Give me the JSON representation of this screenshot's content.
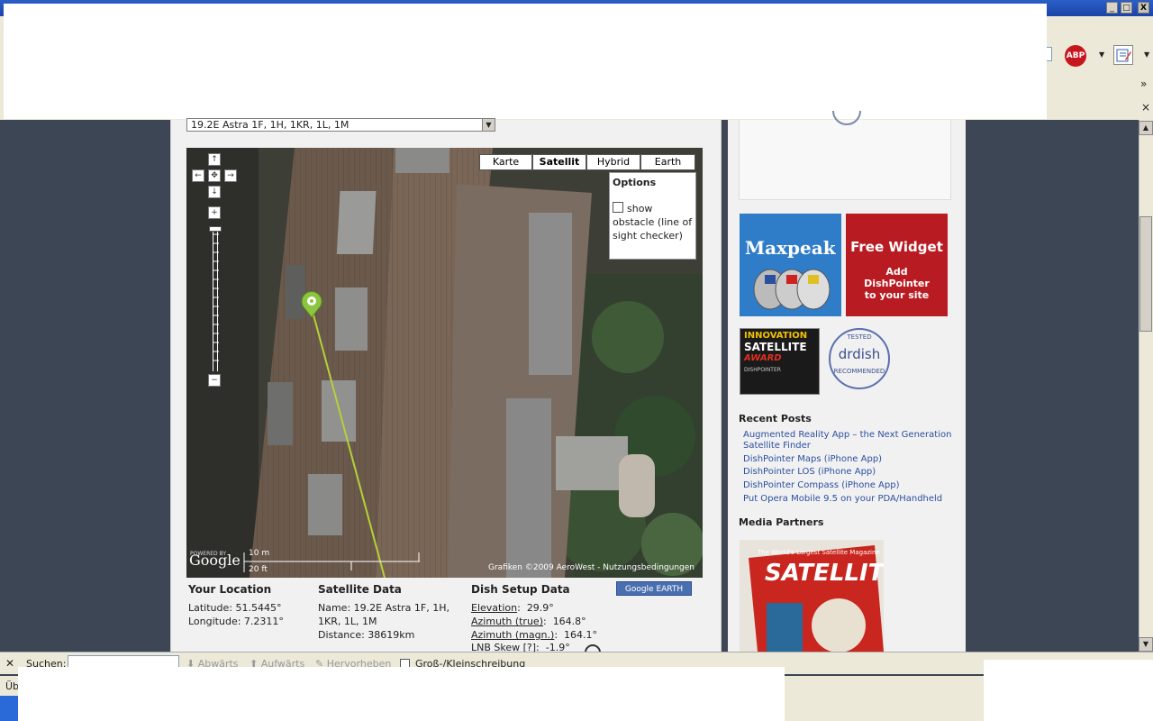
{
  "window": {
    "minimize": "_",
    "maximize": "□",
    "close": "X"
  },
  "toolbar": {
    "abp_label": "ABP",
    "chevron": "»",
    "close_small": "×"
  },
  "satellite_select": {
    "value": "19.2E Astra 1F, 1H, 1KR, 1L, 1M",
    "arrow": "▼"
  },
  "map": {
    "types": [
      "Karte",
      "Satellit",
      "Hybrid",
      "Earth"
    ],
    "selected_type": "Satellit",
    "options_title": "Options",
    "options_checkbox_label": "show obstacle (line of sight checker)",
    "nav": {
      "up": "↑",
      "left": "←",
      "center": "✥",
      "right": "→",
      "down": "↓",
      "zoom_in": "+",
      "zoom_out": "−"
    },
    "powered_by": "POWERED BY",
    "google": "Google",
    "scale_m": "10 m",
    "scale_ft": "20 ft",
    "copyright": "Grafiken ©2009 AeroWest - Nutzungsbedingungen"
  },
  "your_location": {
    "heading": "Your Location",
    "latitude": "Latitude: 51.5445°",
    "longitude": "Longitude: 7.2311°"
  },
  "satellite_data": {
    "heading": "Satellite Data",
    "name_line1": "Name: 19.2E Astra 1F, 1H,",
    "name_line2": "1KR, 1L, 1M",
    "distance": "Distance: 38619km"
  },
  "dish_setup": {
    "heading": "Dish Setup Data",
    "elevation_label": "Elevation",
    "elevation_value": "29.9°",
    "azimuth_true_label": "Azimuth (true)",
    "azimuth_true_value": "164.8°",
    "azimuth_magn_label": "Azimuth (magn.)",
    "azimuth_magn_value": "164.1°",
    "lnb_skew_label": "LNB Skew [?]",
    "lnb_skew_value": "-1.9°",
    "google_earth_button": "Google EARTH"
  },
  "sidebar": {
    "maxpeak": "Maxpeak",
    "free_widget_title": "Free Widget",
    "free_widget_sub": "Add DishPointer to your site",
    "award_line1": "INNOVATION",
    "award_line2": "SATELLITE",
    "award_line3": "AWARD",
    "award_line4": "DISHPOINTER",
    "drdish_top": "TESTED",
    "drdish_mid": "drdish",
    "drdish_bottom": "RECOMMENDED",
    "recent_posts_heading": "Recent Posts",
    "recent_posts": [
      "Augmented Reality App – the Next Generation Satellite Finder",
      "DishPointer Maps (iPhone App)",
      "DishPointer LOS (iPhone App)",
      "DishPointer Compass (iPhone App)",
      "Put Opera Mobile 9.5 on your PDA/Handheld"
    ],
    "media_partners_heading": "Media Partners",
    "magazine_title": "SATELLITE",
    "magazine_tagline": "The World's Largest Satellite Magazine"
  },
  "findbar": {
    "close": "✕",
    "label": "Suchen:",
    "value": "",
    "down": "Abwärts",
    "up": "Aufwärts",
    "highlight": "Hervorheben",
    "match_case": "Groß-/Kleinschreibung"
  },
  "statusbar": {
    "text": "Übe"
  },
  "colors": {
    "page_bg": "#3c4654",
    "content_bg": "#f1f1f1",
    "line_of_sight": "#b5d138",
    "marker": "#8cc63f",
    "link": "#2a4fa0",
    "free_widget_bg": "#b81c22",
    "maxpeak_bg": "#2f7dc8"
  }
}
